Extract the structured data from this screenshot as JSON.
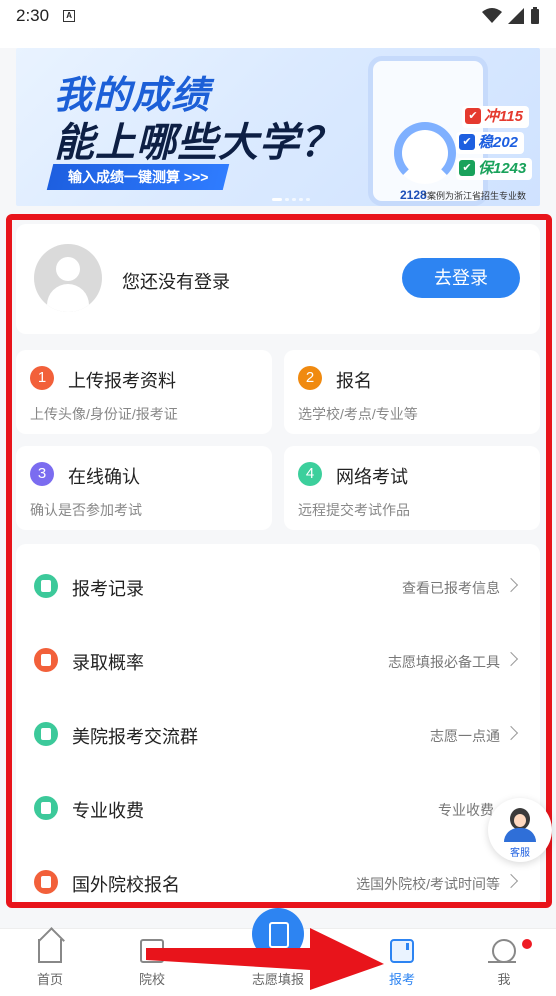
{
  "status_bar": {
    "time": "2:30",
    "notification_glyph": "A"
  },
  "banner": {
    "title_line1": "我的成绩",
    "title_line2": "能上哪些大学？",
    "cta": "输入成绩一键测算 >>>",
    "gauge_score": "2128",
    "tag_rush": "冲115",
    "tag_steady": "稳202",
    "tag_safe": "保1243",
    "note": "*案例为浙江省招生专业数"
  },
  "login": {
    "status_text": "您还没有登录",
    "button": "去登录"
  },
  "steps": [
    {
      "num": "1",
      "title": "上传报考资料",
      "desc": "上传头像/身份证/报考证",
      "color": "#f2603a"
    },
    {
      "num": "2",
      "title": "报名",
      "desc": "选学校/考点/专业等",
      "color": "#f08a10"
    },
    {
      "num": "3",
      "title": "在线确认",
      "desc": "确认是否参加考试",
      "color": "#7b6cf0"
    },
    {
      "num": "4",
      "title": "网络考试",
      "desc": "远程提交考试作品",
      "color": "#3ccf9c"
    }
  ],
  "menu": [
    {
      "title": "报考记录",
      "sub": "查看已报考信息",
      "icon": "list-icon",
      "color": "#3cc99a"
    },
    {
      "title": "录取概率",
      "sub": "志愿填报必备工具",
      "icon": "edit-icon",
      "color": "#f2603a"
    },
    {
      "title": "美院报考交流群",
      "sub": "志愿一点通",
      "icon": "briefcase-icon",
      "color": "#3cc99a"
    },
    {
      "title": "专业收费",
      "sub": "专业收费",
      "icon": "briefcase-icon",
      "color": "#3cc99a"
    },
    {
      "title": "国外院校报名",
      "sub": "选国外院校/考试时间等",
      "icon": "edit-icon",
      "color": "#f2603a"
    }
  ],
  "service_label": "客服",
  "nav": {
    "home": "首页",
    "school": "院校",
    "volunteer": "志愿填报",
    "apply": "报考",
    "me": "我"
  },
  "colors": {
    "accent": "#2d84f2",
    "highlight": "#e8141b"
  }
}
